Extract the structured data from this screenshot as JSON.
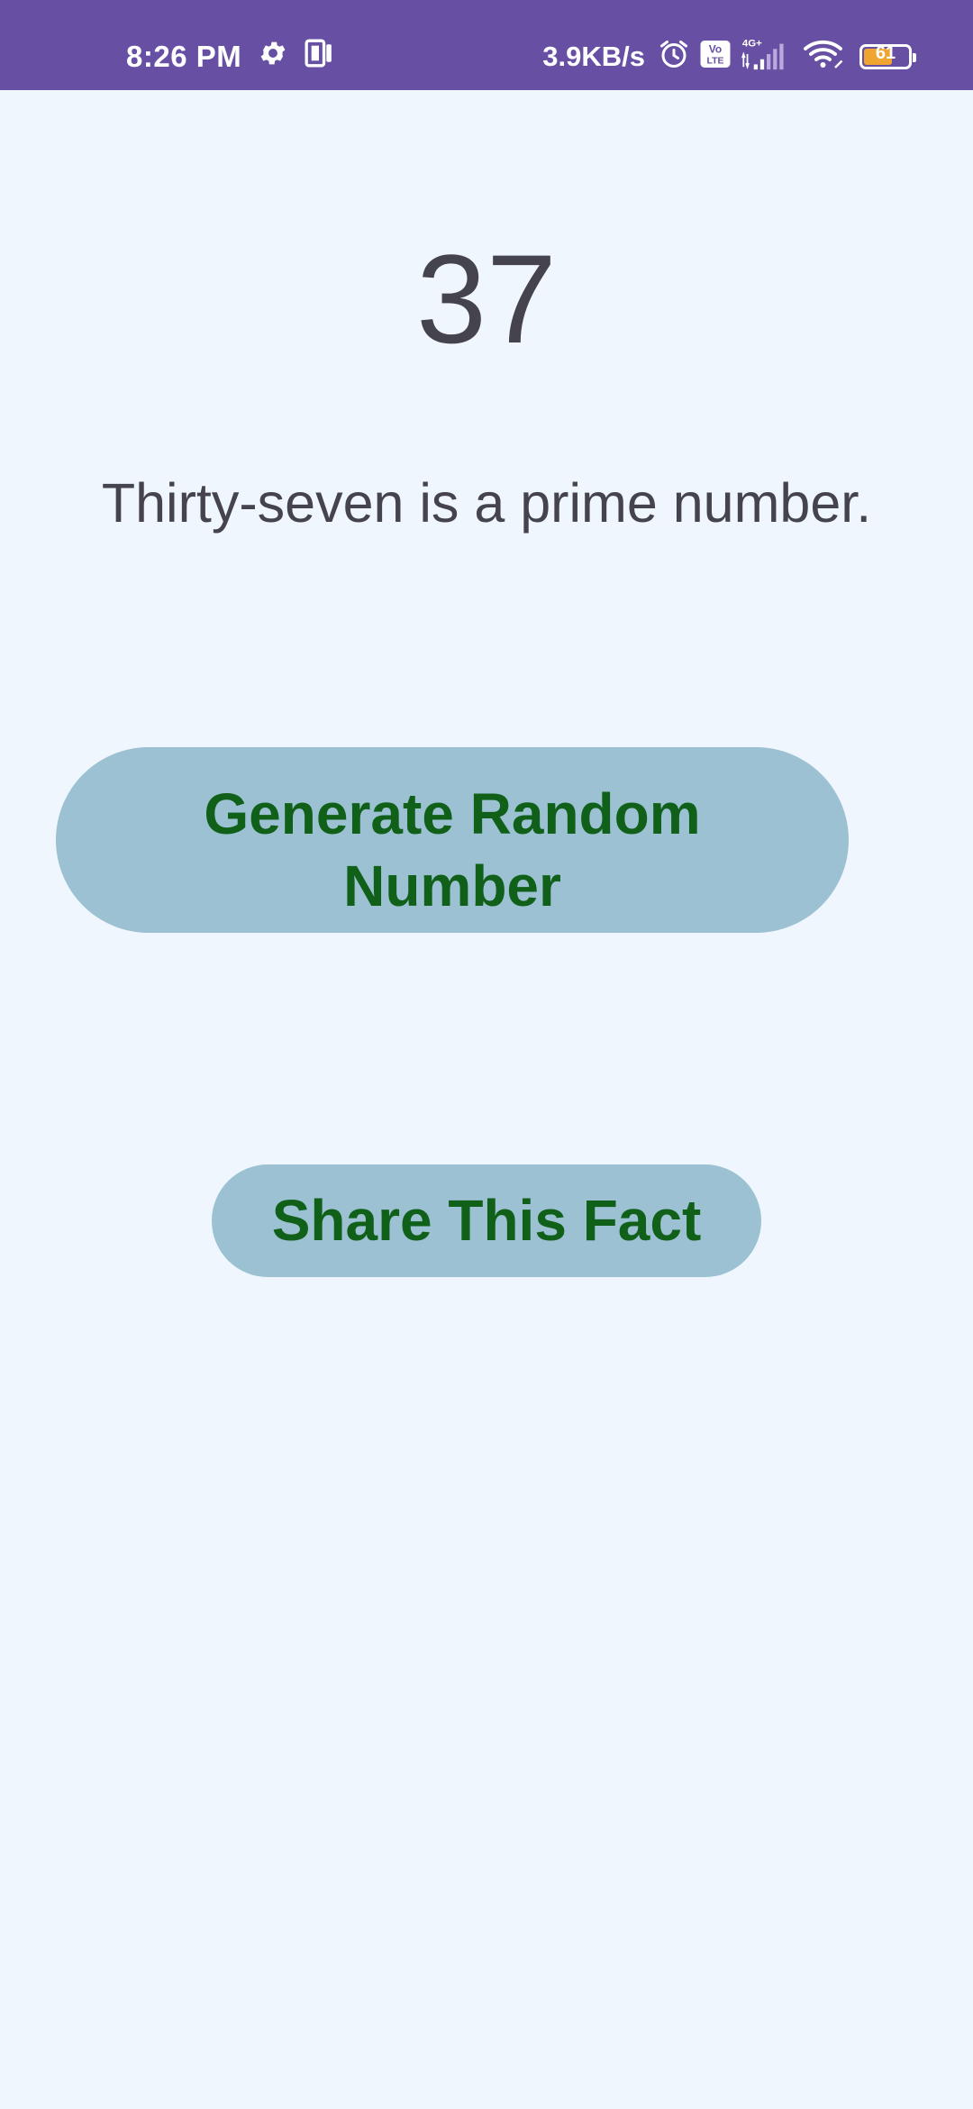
{
  "status_bar": {
    "time": "8:26 PM",
    "network_speed": "3.9KB/s",
    "volte_label": "Vo LTE",
    "network_type": "4G+",
    "battery_level": "61",
    "background_color": "#6750a4",
    "icons": [
      "gear-icon",
      "phone-screen-icon",
      "alarm-icon",
      "volte-icon",
      "signal-icon",
      "wifi-icon",
      "battery-icon"
    ]
  },
  "main": {
    "number": "37",
    "fact": "Thirty-seven is a prime number."
  },
  "buttons": {
    "generate_label": "Generate Random Number",
    "share_label": "Share This Fact",
    "background_color": "#9bc1d2",
    "text_color": "#11601a"
  },
  "theme": {
    "page_background": "#eff6fe",
    "text_color": "#45434d"
  }
}
